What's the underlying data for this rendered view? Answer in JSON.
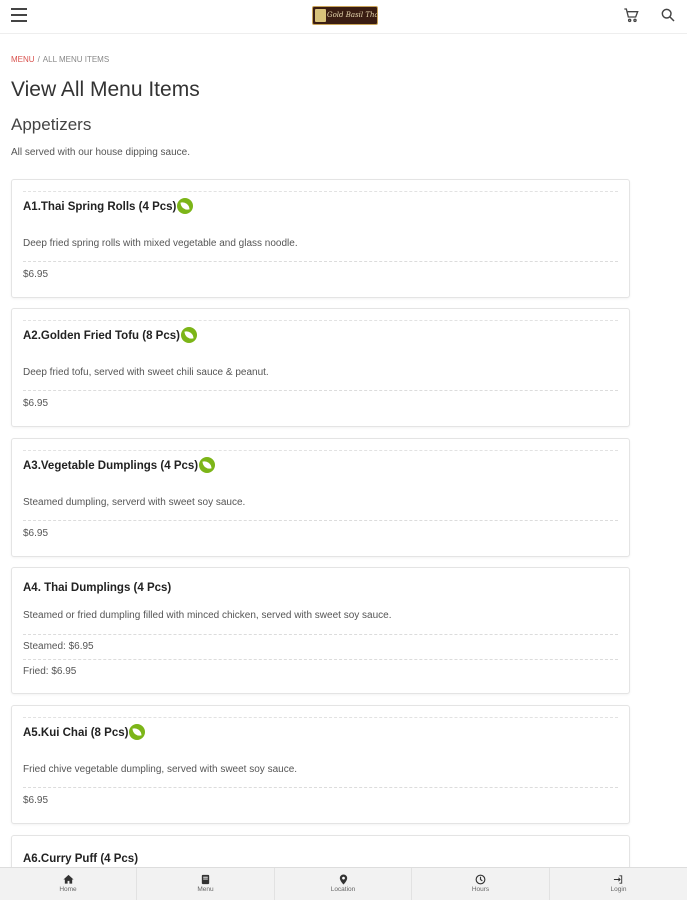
{
  "header": {
    "logo_text": "Gold Basil Thai"
  },
  "breadcrumb": {
    "root": "MENU",
    "separator": "/",
    "current": "ALL MENU ITEMS"
  },
  "page_title": "View All Menu Items",
  "section": {
    "title": "Appetizers",
    "description": "All served with our house dipping sauce."
  },
  "items": [
    {
      "name": "A1.Thai Spring Rolls (4 Pcs)",
      "vegetarian": true,
      "description": "Deep fried spring rolls with mixed vegetable and glass noodle.",
      "prices": [
        "$6.95"
      ]
    },
    {
      "name": "A2.Golden Fried Tofu (8 Pcs)",
      "vegetarian": true,
      "description": "Deep fried tofu, served with sweet chili sauce & peanut.",
      "prices": [
        "$6.95"
      ]
    },
    {
      "name": "A3.Vegetable Dumplings (4 Pcs)",
      "vegetarian": true,
      "description": "Steamed dumpling, serverd with sweet soy sauce.",
      "prices": [
        "$6.95"
      ]
    },
    {
      "name": "A4. Thai Dumplings (4 Pcs)",
      "vegetarian": false,
      "description": "Steamed or fried dumpling filled with minced chicken, served with sweet soy sauce.",
      "prices": [
        "Steamed: $6.95",
        "Fried: $6.95"
      ]
    },
    {
      "name": "A5.Kui Chai (8 Pcs)",
      "vegetarian": true,
      "description": "Fried chive vegetable dumpling, served with sweet soy sauce.",
      "prices": [
        "$6.95"
      ]
    },
    {
      "name": "A6.Curry Puff (4 Pcs)",
      "vegetarian": false,
      "description": "",
      "prices": []
    }
  ],
  "bottom_nav": [
    {
      "label": "Home",
      "icon": "home-icon"
    },
    {
      "label": "Menu",
      "icon": "book-icon"
    },
    {
      "label": "Location",
      "icon": "map-pin-icon"
    },
    {
      "label": "Hours",
      "icon": "clock-icon"
    },
    {
      "label": "Login",
      "icon": "login-icon"
    }
  ],
  "colors": {
    "accent": "#d9534f",
    "veg_badge": "#7cb518"
  }
}
